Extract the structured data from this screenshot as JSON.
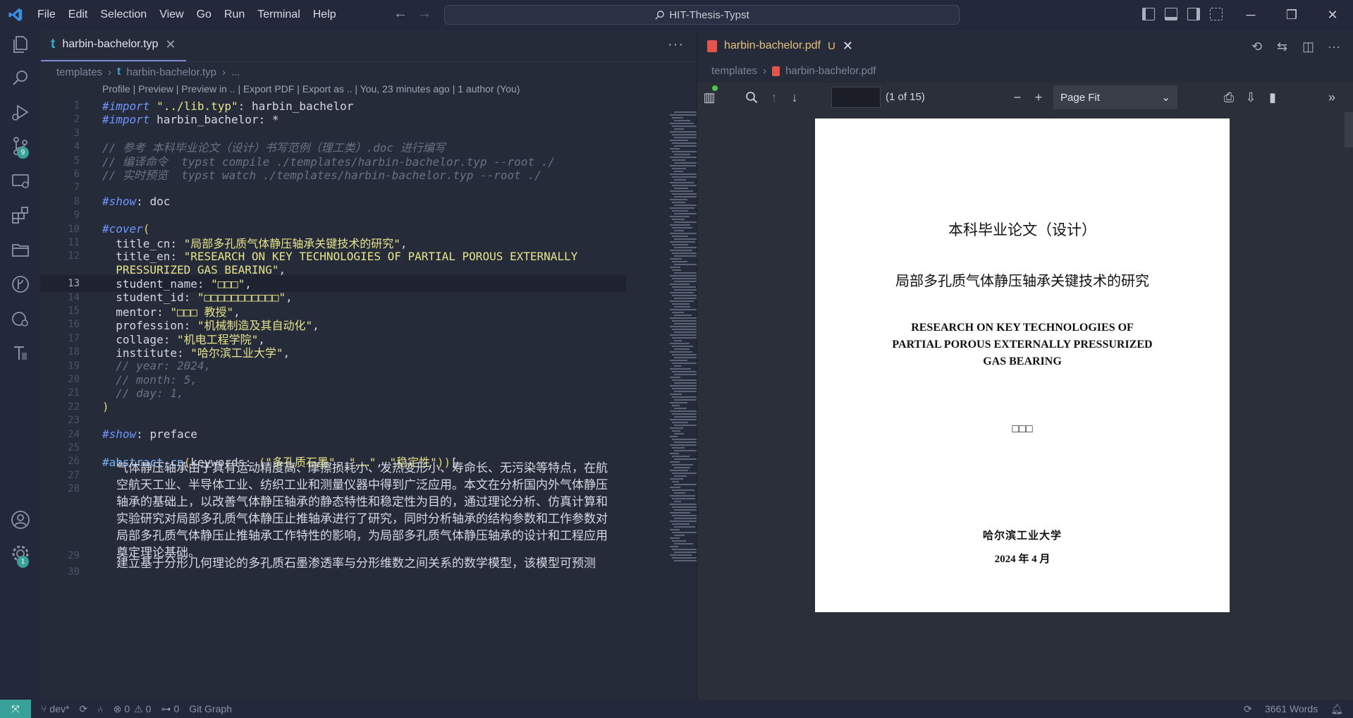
{
  "menu": [
    "File",
    "Edit",
    "Selection",
    "View",
    "Go",
    "Run",
    "Terminal",
    "Help"
  ],
  "command_center": "HIT-Thesis-Typst",
  "window_controls": {
    "minimize": "─",
    "restore": "❐",
    "close": "✕"
  },
  "activity_badges": {
    "source_control": "9",
    "settings": "1"
  },
  "editor": {
    "tab_icon": "t",
    "tab_label": "harbin-bachelor.typ",
    "more": "···",
    "breadcrumb": {
      "folder": "templates",
      "icon": "t",
      "file": "harbin-bachelor.typ",
      "tail": "..."
    },
    "codelens": "Profile | Preview | Preview in .. | Export PDF | Export as .. | You, 23 minutes ago | 1 author (You)",
    "lines": [
      {
        "n": "1",
        "parts": [
          [
            "k",
            "#import"
          ],
          [
            "",
            " "
          ],
          [
            "s",
            "\"../lib.typ\""
          ],
          [
            "",
            ": harbin_bachelor"
          ]
        ]
      },
      {
        "n": "2",
        "parts": [
          [
            "k",
            "#import"
          ],
          [
            "",
            " harbin_bachelor: *"
          ]
        ]
      },
      {
        "n": "3",
        "parts": []
      },
      {
        "n": "4",
        "parts": [
          [
            "c",
            "// 参考 本科毕业论文（设计）书写范例（理工类）.doc 进行编写"
          ]
        ]
      },
      {
        "n": "5",
        "parts": [
          [
            "c",
            "// 编译命令  typst compile ./templates/harbin-bachelor.typ --root ./"
          ]
        ]
      },
      {
        "n": "6",
        "parts": [
          [
            "c",
            "// 实时预览  typst watch ./templates/harbin-bachelor.typ --root ./"
          ]
        ]
      },
      {
        "n": "7",
        "parts": []
      },
      {
        "n": "8",
        "parts": [
          [
            "k",
            "#show"
          ],
          [
            "",
            ": doc"
          ]
        ]
      },
      {
        "n": "9",
        "parts": []
      },
      {
        "n": "10",
        "parts": [
          [
            "k",
            "#cover"
          ],
          [
            "p",
            "("
          ]
        ]
      },
      {
        "n": "11",
        "parts": [
          [
            "",
            "  title_cn: "
          ],
          [
            "s",
            "\"局部多孔质气体静压轴承关键技术的研究\""
          ],
          [
            "",
            ","
          ]
        ]
      },
      {
        "n": "12",
        "parts": [
          [
            "",
            "  title_en: "
          ],
          [
            "s",
            "\"RESEARCH ON KEY TECHNOLOGIES OF PARTIAL POROUS EXTERNALLY"
          ]
        ]
      },
      {
        "n": "",
        "parts": [
          [
            "s",
            "  PRESSURIZED GAS BEARING\""
          ],
          [
            "",
            ","
          ]
        ]
      },
      {
        "n": "13",
        "cur": true,
        "parts": [
          [
            "",
            "  student_name: "
          ],
          [
            "s",
            "\"□□□\""
          ],
          [
            "",
            ","
          ]
        ]
      },
      {
        "n": "14",
        "parts": [
          [
            "",
            "  student_id: "
          ],
          [
            "s",
            "\"□□□□□□□□□□□\""
          ],
          [
            "",
            ","
          ]
        ]
      },
      {
        "n": "15",
        "parts": [
          [
            "",
            "  mentor: "
          ],
          [
            "s",
            "\"□□□ 教授\""
          ],
          [
            "",
            ","
          ]
        ]
      },
      {
        "n": "16",
        "parts": [
          [
            "",
            "  profession: "
          ],
          [
            "s",
            "\"机械制造及其自动化\""
          ],
          [
            "",
            ","
          ]
        ]
      },
      {
        "n": "17",
        "parts": [
          [
            "",
            "  collage: "
          ],
          [
            "s",
            "\"机电工程学院\""
          ],
          [
            "",
            ","
          ]
        ]
      },
      {
        "n": "18",
        "parts": [
          [
            "",
            "  institute: "
          ],
          [
            "s",
            "\"哈尔滨工业大学\""
          ],
          [
            "",
            ","
          ]
        ]
      },
      {
        "n": "19",
        "parts": [
          [
            "c",
            "  // year: 2024,"
          ]
        ]
      },
      {
        "n": "20",
        "parts": [
          [
            "c",
            "  // month: 5,"
          ]
        ]
      },
      {
        "n": "21",
        "parts": [
          [
            "c",
            "  // day: 1,"
          ]
        ]
      },
      {
        "n": "22",
        "parts": [
          [
            "p",
            ")"
          ]
        ]
      },
      {
        "n": "23",
        "parts": []
      },
      {
        "n": "24",
        "parts": [
          [
            "k",
            "#show"
          ],
          [
            "",
            ": preface"
          ]
        ]
      },
      {
        "n": "25",
        "parts": []
      },
      {
        "n": "26",
        "parts": [
          [
            "f",
            "#abstract_cn"
          ],
          [
            "p",
            "("
          ],
          [
            "",
            "keywords: "
          ],
          [
            "p",
            "("
          ],
          [
            "s",
            "\"多孔质石墨\""
          ],
          [
            "",
            ", "
          ],
          [
            "s",
            "\"……\""
          ],
          [
            "",
            ", "
          ],
          [
            "s",
            "\"稳定性\""
          ],
          [
            "p",
            ")"
          ],
          [
            "p",
            ")"
          ],
          [
            "",
            "["
          ]
        ]
      },
      {
        "n": "27",
        "parts": []
      },
      {
        "n": "28",
        "parts": []
      }
    ],
    "paragraph1": "气体静压轴承由于具有运动精度高、摩擦损耗小、发热变形小、寿命长、无污染等特点，在航空航天工业、半导体工业、纺织工业和测量仪器中得到广泛应用。本文在分析国内外气体静压轴承的基础上，以改善气体静压轴承的静态特性和稳定性为目的，通过理论分析、仿真计算和实验研究对局部多孔质气体静压止推轴承进行了研究，同时分析轴承的结构参数和工作参数对局部多孔质气体静压止推轴承工作特性的影响，为局部多孔质气体静压轴承的设计和工程应用奠定理论基础。",
    "line29": "29",
    "line30": "30",
    "paragraph2": "建立基于分形几何理论的多孔质石墨渗透率与分形维数之间关系的数学模型，该模型可预测"
  },
  "preview": {
    "tab_label": "harbin-bachelor.pdf",
    "tab_status": "U",
    "tab_close": "✕",
    "breadcrumb": {
      "folder": "templates",
      "file": "harbin-bachelor.pdf"
    },
    "page_count": "(1 of 15)",
    "zoom": "Page Fit",
    "page": {
      "title": "本科毕业论文（设计）",
      "subtitle": "局部多孔质气体静压轴承关键技术的研究",
      "en_line1": "RESEARCH ON KEY TECHNOLOGIES OF",
      "en_line2": "PARTIAL POROUS EXTERNALLY PRESSURIZED",
      "en_line3": "GAS BEARING",
      "name": "□□□",
      "university": "哈尔滨工业大学",
      "date": "2024 年 4 月"
    }
  },
  "status": {
    "branch": "dev*",
    "errors": "0",
    "warnings": "0",
    "ports": "0",
    "git_graph": "Git Graph",
    "words": "3661 Words"
  }
}
